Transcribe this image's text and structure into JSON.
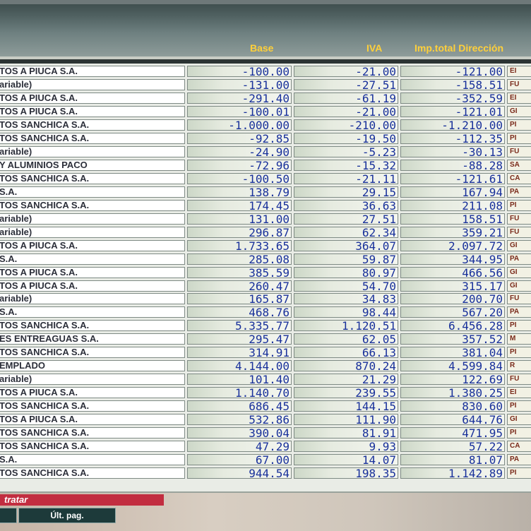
{
  "columns": {
    "base": "Base",
    "iva": "IVA",
    "imp_total": "Imp.total",
    "direccion": "Dirección"
  },
  "rows": [
    {
      "name": "TOS A PIUCA S.A.",
      "base": "-100.00",
      "iva": "-21.00",
      "total": "-121.00",
      "dir": "EI"
    },
    {
      "name": "ariable)",
      "base": "-131.00",
      "iva": "-27.51",
      "total": "-158.51",
      "dir": "FU"
    },
    {
      "name": "TOS A PIUCA S.A.",
      "base": "-291.40",
      "iva": "-61.19",
      "total": "-352.59",
      "dir": "EI"
    },
    {
      "name": "TOS A PIUCA S.A.",
      "base": "-100.01",
      "iva": "-21.00",
      "total": "-121.01",
      "dir": "GI"
    },
    {
      "name": "TOS SANCHICA S.A.",
      "base": "-1.000.00",
      "iva": "-210.00",
      "total": "-1.210.00",
      "dir": "PI"
    },
    {
      "name": "TOS SANCHICA S.A.",
      "base": "-92.85",
      "iva": "-19.50",
      "total": "-112.35",
      "dir": "PI"
    },
    {
      "name": "ariable)",
      "base": "-24.90",
      "iva": "-5.23",
      "total": "-30.13",
      "dir": "FU"
    },
    {
      "name": "Y ALUMINIOS PACO",
      "base": "-72.96",
      "iva": "-15.32",
      "total": "-88.28",
      "dir": "SA"
    },
    {
      "name": "TOS SANCHICA S.A.",
      "base": "-100.50",
      "iva": "-21.11",
      "total": "-121.61",
      "dir": "CA"
    },
    {
      "name": "S.A.",
      "base": "138.79",
      "iva": "29.15",
      "total": "167.94",
      "dir": "PA"
    },
    {
      "name": "TOS SANCHICA S.A.",
      "base": "174.45",
      "iva": "36.63",
      "total": "211.08",
      "dir": "PI"
    },
    {
      "name": "ariable)",
      "base": "131.00",
      "iva": "27.51",
      "total": "158.51",
      "dir": "FU"
    },
    {
      "name": "ariable)",
      "base": "296.87",
      "iva": "62.34",
      "total": "359.21",
      "dir": "FU"
    },
    {
      "name": "TOS A PIUCA S.A.",
      "base": "1.733.65",
      "iva": "364.07",
      "total": "2.097.72",
      "dir": "GI"
    },
    {
      "name": "S.A.",
      "base": "285.08",
      "iva": "59.87",
      "total": "344.95",
      "dir": "PA"
    },
    {
      "name": "TOS A PIUCA S.A.",
      "base": "385.59",
      "iva": "80.97",
      "total": "466.56",
      "dir": "GI"
    },
    {
      "name": "TOS A PIUCA S.A.",
      "base": "260.47",
      "iva": "54.70",
      "total": "315.17",
      "dir": "GI"
    },
    {
      "name": "ariable)",
      "base": "165.87",
      "iva": "34.83",
      "total": "200.70",
      "dir": "FU"
    },
    {
      "name": "S.A.",
      "base": "468.76",
      "iva": "98.44",
      "total": "567.20",
      "dir": "PA"
    },
    {
      "name": "TOS SANCHICA S.A.",
      "base": "5.335.77",
      "iva": "1.120.51",
      "total": "6.456.28",
      "dir": "PI"
    },
    {
      "name": "ES ENTREAGUAS S.A.",
      "base": "295.47",
      "iva": "62.05",
      "total": "357.52",
      "dir": "M"
    },
    {
      "name": "TOS SANCHICA S.A.",
      "base": "314.91",
      "iva": "66.13",
      "total": "381.04",
      "dir": "PI"
    },
    {
      "name": "EMPLADO",
      "base": "4.144.00",
      "iva": "870.24",
      "total": "4.599.84",
      "dir": "R"
    },
    {
      "name": "ariable)",
      "base": "101.40",
      "iva": "21.29",
      "total": "122.69",
      "dir": "FU"
    },
    {
      "name": "TOS A PIUCA S.A.",
      "base": "1.140.70",
      "iva": "239.55",
      "total": "1.380.25",
      "dir": "EI"
    },
    {
      "name": "TOS SANCHICA S.A.",
      "base": "686.45",
      "iva": "144.15",
      "total": "830.60",
      "dir": "PI"
    },
    {
      "name": "TOS A PIUCA S.A.",
      "base": "532.86",
      "iva": "111.90",
      "total": "644.76",
      "dir": "GI"
    },
    {
      "name": "TOS SANCHICA S.A.",
      "base": "390.04",
      "iva": "81.91",
      "total": "471.95",
      "dir": "PI"
    },
    {
      "name": "TOS SANCHICA S.A.",
      "base": "47.29",
      "iva": "9.93",
      "total": "57.22",
      "dir": "CA"
    },
    {
      "name": "S.A.",
      "base": "67.00",
      "iva": "14.07",
      "total": "81.07",
      "dir": "PA"
    },
    {
      "name": "TOS SANCHICA S.A.",
      "base": "944.54",
      "iva": "198.35",
      "total": "1.142.89",
      "dir": "PI"
    }
  ],
  "footer": {
    "status": "tratar",
    "last_page_label": "Últ. pag."
  }
}
